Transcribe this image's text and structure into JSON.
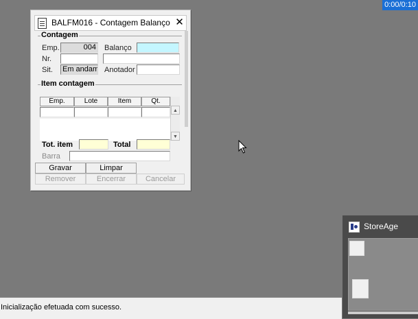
{
  "timer": "0:00/0:10",
  "dialog": {
    "title": "BALFM016 - Contagem Balanço",
    "contagem": {
      "section_title": "Contagem",
      "emp_label": "Emp.",
      "emp_value": "004",
      "balanco_label": "Balanço",
      "balanco_value": "",
      "nr_label": "Nr.",
      "nr_value": "",
      "nr_extra_value": "",
      "sit_label": "Sit.",
      "sit_value": "Em andamento",
      "anotador_label": "Anotador",
      "anotador_value": ""
    },
    "item_contagem": {
      "section_title": "Item contagem",
      "columns": [
        "Emp.",
        "Lote",
        "Item",
        "Qt."
      ],
      "tot_item_label": "Tot. item",
      "tot_item_value": "",
      "total_label": "Total",
      "total_value": "",
      "barra_label": "Barra",
      "barra_value": ""
    },
    "buttons": {
      "gravar": "Gravar",
      "limpar": "Limpar",
      "remover": "Remover",
      "encerrar": "Encerrar",
      "cancelar": "Cancelar"
    }
  },
  "statusbar": {
    "message": "Inicialização efetuada com sucesso."
  },
  "taskbar_preview": {
    "title": "StoreAge"
  },
  "colors": {
    "desktop": "#7a7a7a",
    "timer_bg": "#1a6fd6",
    "balanco_field": "#c4f6ff",
    "total_fields": "#ffffd6"
  }
}
